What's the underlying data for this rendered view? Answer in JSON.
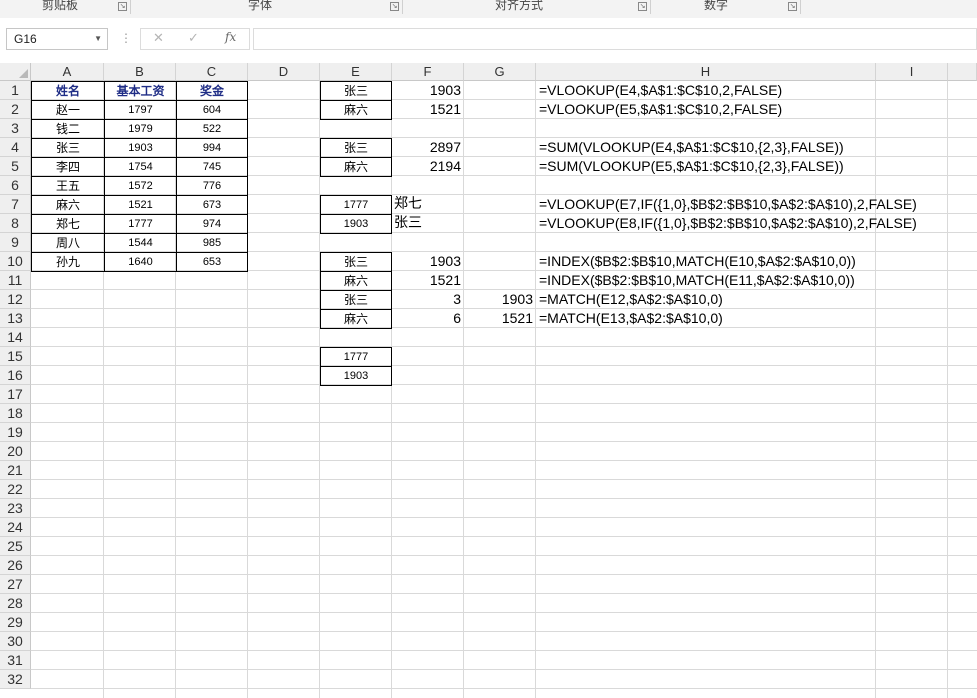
{
  "ribbon": {
    "groups": [
      "剪贴板",
      "字体",
      "对齐方式",
      "数字"
    ]
  },
  "formula_bar": {
    "name_box": "G16",
    "cancel": "✕",
    "enter": "✓",
    "fx": "fx",
    "formula": ""
  },
  "columns": [
    "A",
    "B",
    "C",
    "D",
    "E",
    "F",
    "G",
    "H",
    "I"
  ],
  "rows": [
    "1",
    "2",
    "3",
    "4",
    "5",
    "6",
    "7",
    "8",
    "9",
    "10",
    "11",
    "12",
    "13",
    "14",
    "15",
    "16",
    "17",
    "18",
    "19",
    "20",
    "21",
    "22",
    "23",
    "24",
    "25",
    "26",
    "27",
    "28",
    "29",
    "30",
    "31",
    "32"
  ],
  "table": {
    "headers": [
      "姓名",
      "基本工资",
      "奖金"
    ],
    "rows": [
      [
        "赵一",
        "1797",
        "604"
      ],
      [
        "钱二",
        "1979",
        "522"
      ],
      [
        "张三",
        "1903",
        "994"
      ],
      [
        "李四",
        "1754",
        "745"
      ],
      [
        "王五",
        "1572",
        "776"
      ],
      [
        "麻六",
        "1521",
        "673"
      ],
      [
        "郑七",
        "1777",
        "974"
      ],
      [
        "周八",
        "1544",
        "985"
      ],
      [
        "孙九",
        "1640",
        "653"
      ]
    ]
  },
  "lookups": {
    "e1": "张三",
    "f1": "1903",
    "h1": "=VLOOKUP(E4,$A$1:$C$10,2,FALSE)",
    "e2": "麻六",
    "f2": "1521",
    "h2": "=VLOOKUP(E5,$A$1:$C$10,2,FALSE)",
    "e4": "张三",
    "f4": "2897",
    "h4": "=SUM(VLOOKUP(E4,$A$1:$C$10,{2,3},FALSE))",
    "e5": "麻六",
    "f5": "2194",
    "h5": "=SUM(VLOOKUP(E5,$A$1:$C$10,{2,3},FALSE))",
    "e7": "1777",
    "f7": "郑七",
    "h7": "=VLOOKUP(E7,IF({1,0},$B$2:$B$10,$A$2:$A$10),2,FALSE)",
    "e8": "1903",
    "f8": "张三",
    "h8": "=VLOOKUP(E8,IF({1,0},$B$2:$B$10,$A$2:$A$10),2,FALSE)",
    "e10": "张三",
    "f10": "1903",
    "h10": "=INDEX($B$2:$B$10,MATCH(E10,$A$2:$A$10,0))",
    "e11": "麻六",
    "f11": "1521",
    "h11": "=INDEX($B$2:$B$10,MATCH(E11,$A$2:$A$10,0))",
    "e12": "张三",
    "f12": "3",
    "g12": "1903",
    "h12": "=MATCH(E12,$A$2:$A$10,0)",
    "e13": "麻六",
    "f13": "6",
    "g13": "1521",
    "h13": "=MATCH(E13,$A$2:$A$10,0)",
    "e15": "1777",
    "e16": "1903"
  }
}
